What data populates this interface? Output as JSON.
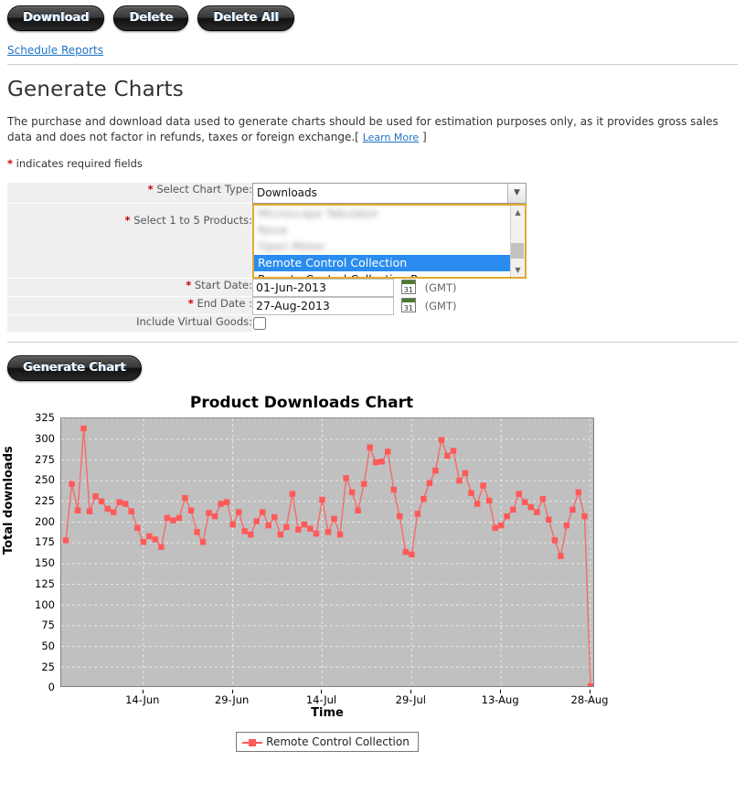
{
  "toolbar": {
    "download_label": "Download",
    "delete_label": "Delete",
    "delete_all_label": "Delete All"
  },
  "schedule_link": "Schedule Reports",
  "page_title": "Generate Charts",
  "intro_text": "The purchase and download data used to generate charts should be used for estimation purposes only, as it provides gross sales data and does not factor in refunds, taxes or foreign exchange.[ ",
  "learn_more_label": "Learn More",
  "intro_tail": " ]",
  "required_note": " indicates required fields",
  "form": {
    "chart_type_label": "Select Chart Type:",
    "chart_type_value": "Downloads",
    "products_label": "Select 1 to 5 Products:",
    "products": [
      {
        "label": "Microscope Tabulator",
        "state": "blurred"
      },
      {
        "label": "Nova",
        "state": "blurred"
      },
      {
        "label": "Open Meter",
        "state": "blurred"
      },
      {
        "label": "Remote Control Collection",
        "state": "selected"
      },
      {
        "label": "Remote Control Collection Pro",
        "state": "normal"
      }
    ],
    "start_date_label": "Start Date:",
    "start_date_value": "01-Jun-2013",
    "end_date_label": "End Date :",
    "end_date_value": "27-Aug-2013",
    "gmt_label": "(GMT)",
    "virtual_goods_label": "Include Virtual Goods:",
    "virtual_goods_checked": false,
    "calendar_icon_day": "31",
    "generate_label": "Generate Chart"
  },
  "colors": {
    "series": "#FF5A5A",
    "plot_background": "#C0C0C0",
    "gridline": "#E8E8E8",
    "accent_link": "#1F73C4",
    "required_star": "#CC0000",
    "listbox_border": "#E3A82E",
    "selection": "#2A8CF0"
  },
  "chart_data": {
    "type": "line",
    "title": "Product Downloads Chart",
    "xlabel": "Time",
    "ylabel": "Total downloads",
    "ylim": [
      0,
      325
    ],
    "yticks": [
      0,
      25,
      50,
      75,
      100,
      125,
      150,
      175,
      200,
      225,
      250,
      275,
      300,
      325
    ],
    "xticks": [
      "14-Jun",
      "29-Jun",
      "14-Jul",
      "29-Jul",
      "13-Aug",
      "28-Aug"
    ],
    "xtick_indices": [
      13,
      28,
      43,
      58,
      73,
      88
    ],
    "grid": true,
    "legend_position": "bottom",
    "marker": "square",
    "series": [
      {
        "name": "Remote Control Collection",
        "color": "#FF5A5A",
        "x": [
          "01-Jun",
          "02-Jun",
          "03-Jun",
          "04-Jun",
          "05-Jun",
          "06-Jun",
          "07-Jun",
          "08-Jun",
          "09-Jun",
          "10-Jun",
          "11-Jun",
          "12-Jun",
          "13-Jun",
          "14-Jun",
          "15-Jun",
          "16-Jun",
          "17-Jun",
          "18-Jun",
          "19-Jun",
          "20-Jun",
          "21-Jun",
          "22-Jun",
          "23-Jun",
          "24-Jun",
          "25-Jun",
          "26-Jun",
          "27-Jun",
          "28-Jun",
          "29-Jun",
          "30-Jun",
          "01-Jul",
          "02-Jul",
          "03-Jul",
          "04-Jul",
          "05-Jul",
          "06-Jul",
          "07-Jul",
          "08-Jul",
          "09-Jul",
          "10-Jul",
          "11-Jul",
          "12-Jul",
          "13-Jul",
          "14-Jul",
          "15-Jul",
          "16-Jul",
          "17-Jul",
          "18-Jul",
          "19-Jul",
          "20-Jul",
          "21-Jul",
          "22-Jul",
          "23-Jul",
          "24-Jul",
          "25-Jul",
          "26-Jul",
          "27-Jul",
          "28-Jul",
          "29-Jul",
          "30-Jul",
          "31-Jul",
          "01-Aug",
          "02-Aug",
          "03-Aug",
          "04-Aug",
          "05-Aug",
          "06-Aug",
          "07-Aug",
          "08-Aug",
          "09-Aug",
          "10-Aug",
          "11-Aug",
          "12-Aug",
          "13-Aug",
          "14-Aug",
          "15-Aug",
          "16-Aug",
          "17-Aug",
          "18-Aug",
          "19-Aug",
          "20-Aug",
          "21-Aug",
          "22-Aug",
          "23-Aug",
          "24-Aug",
          "25-Aug",
          "26-Aug",
          "27-Aug",
          "28-Aug"
        ],
        "values": [
          178,
          246,
          214,
          313,
          213,
          231,
          225,
          216,
          212,
          224,
          222,
          213,
          193,
          176,
          183,
          179,
          170,
          205,
          202,
          205,
          229,
          214,
          188,
          176,
          211,
          207,
          222,
          224,
          197,
          212,
          189,
          185,
          201,
          212,
          196,
          206,
          185,
          194,
          234,
          191,
          197,
          192,
          186,
          227,
          188,
          204,
          185,
          253,
          236,
          214,
          246,
          290,
          272,
          273,
          285,
          239,
          207,
          164,
          161,
          210,
          228,
          247,
          262,
          299,
          280,
          286,
          250,
          259,
          235,
          222,
          244,
          226,
          193,
          196,
          207,
          215,
          234,
          224,
          218,
          212,
          228,
          203,
          178,
          159,
          196,
          215,
          236,
          207,
          2
        ]
      }
    ]
  }
}
